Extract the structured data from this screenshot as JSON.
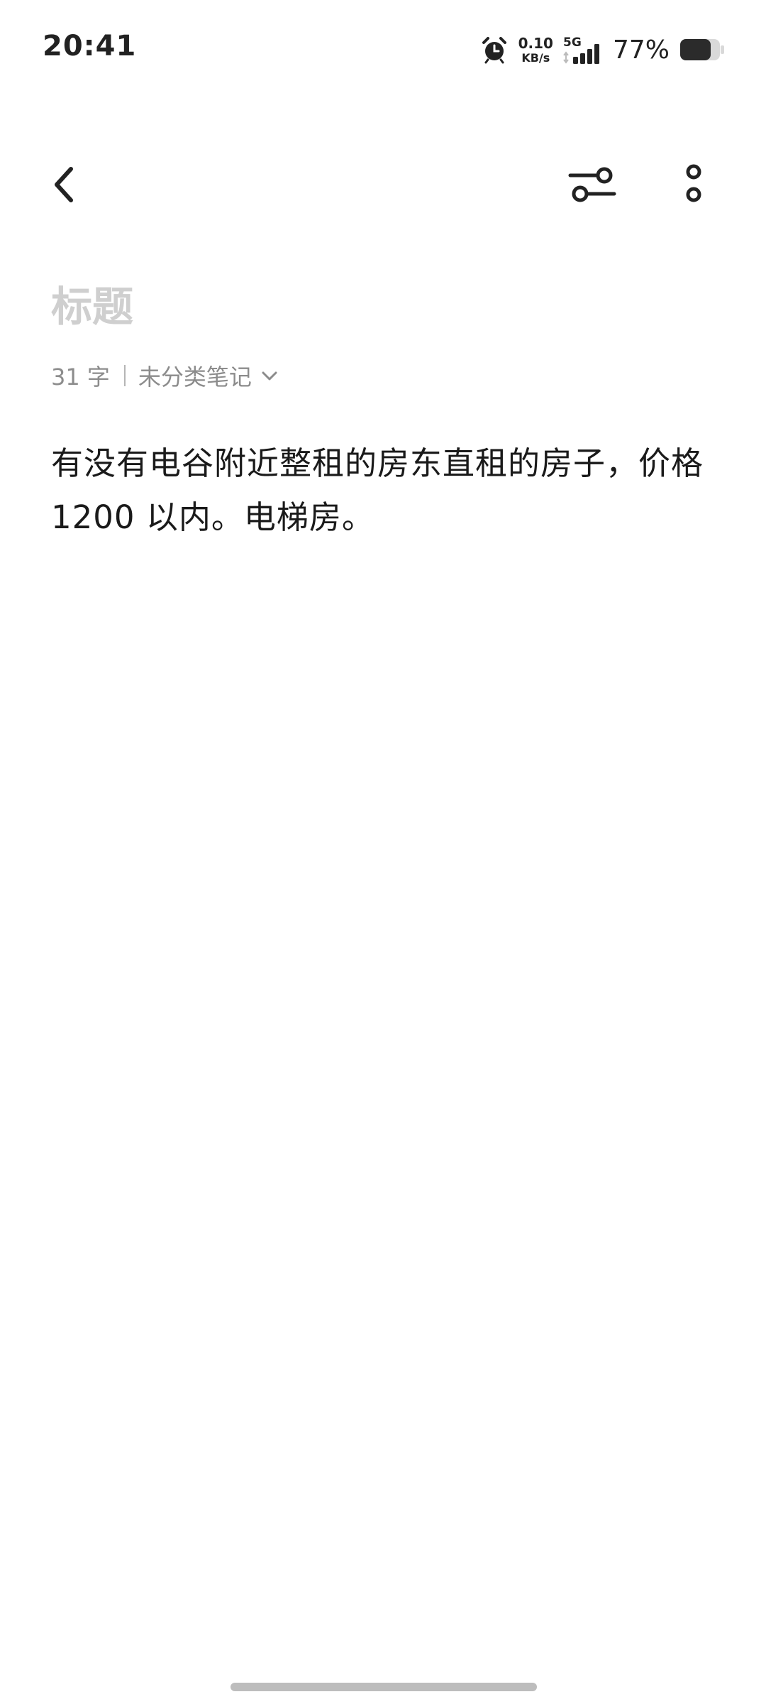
{
  "status_bar": {
    "time": "20:41",
    "net_speed_value": "0.10",
    "net_speed_unit": "KB/s",
    "network_type": "5G",
    "battery_percent": "77%",
    "battery_level": 0.77
  },
  "toolbar": {
    "back_icon": "chevron-left",
    "filter_icon": "sliders",
    "more_icon": "more-vertical"
  },
  "note": {
    "title_placeholder": "标题",
    "char_count": "31 字",
    "category": "未分类笔记",
    "body": "有没有电谷附近整租的房东直租的房子，价格1200 以内。电梯房。"
  }
}
